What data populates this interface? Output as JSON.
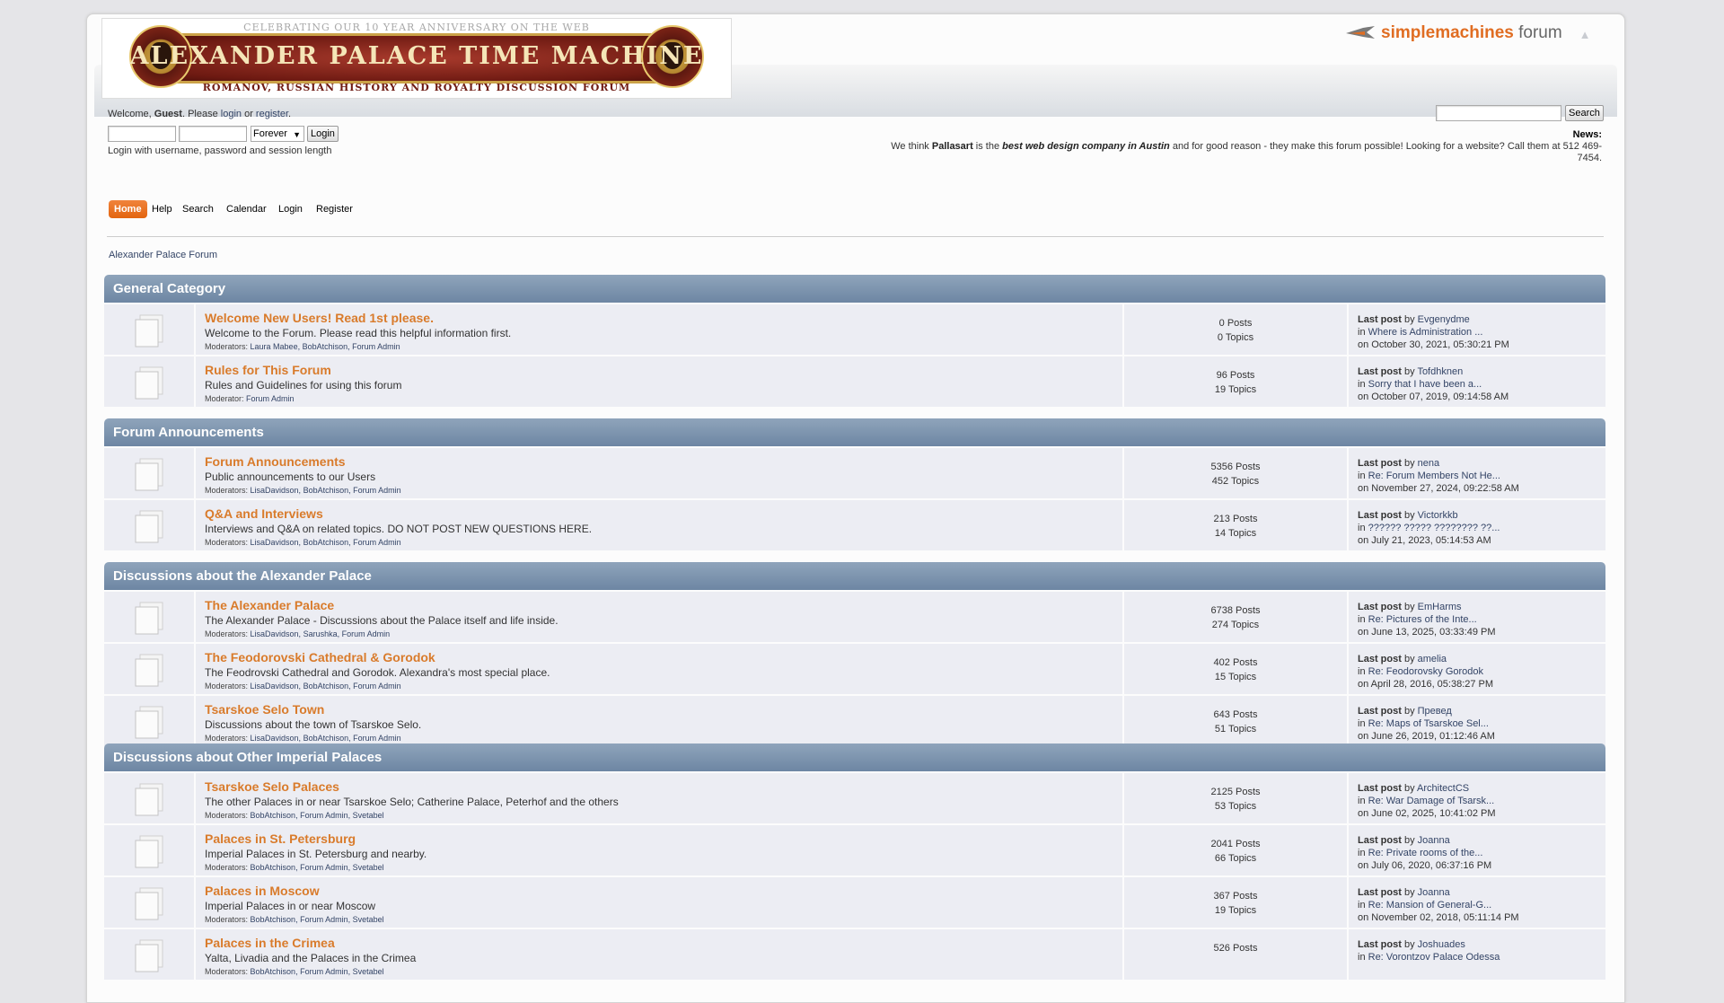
{
  "header": {
    "anniversary": "Celebrating our 10 year anniversary on the web",
    "title": "Alexander Palace Time Machine",
    "subtitle": "Romanov, Russian History and Royalty Discussion Forum",
    "smf_logo_bold": "simplemachines",
    "smf_logo_rest": " forum",
    "collapse_icon": "collapse-icon"
  },
  "user": {
    "welcome_prefix": "Welcome, ",
    "guest": "Guest",
    "please": ". Please ",
    "login_link": "login",
    "or": " or ",
    "register_link": "register",
    "end": ".",
    "login_length": "Forever",
    "login_button": "Login",
    "hint": "Login with username, password and session length"
  },
  "search": {
    "button": "Search",
    "value": ""
  },
  "news": {
    "title": "News:",
    "p1": "We think ",
    "b1": "Pallasart",
    "p2": " is the ",
    "b2": "best web design company in Austin",
    "p3": " and for good reason - they make this forum possible! Looking for a website? Call them at 512 469-7454."
  },
  "menu": [
    "Home",
    "Help",
    "Search",
    "Calendar",
    "Login",
    "Register"
  ],
  "breadcrumb": "Alexander Palace Forum",
  "categories": [
    {
      "name": "General Category",
      "boards": [
        {
          "name": "Welcome New Users! Read 1st please.",
          "desc": "Welcome to the Forum. Please read this helpful information first.",
          "mods_label": "Moderators: ",
          "mods": "Laura Mabee, BobAtchison, Forum Admin",
          "posts": "0 Posts",
          "topics": "0 Topics",
          "last_by": "Evgenydme",
          "last_in": "Where is Administration ...",
          "last_on": "on October 30, 2021, 05:30:21 PM"
        },
        {
          "name": "Rules for This Forum",
          "desc": "Rules and Guidelines for using this forum",
          "mods_label": "Moderator: ",
          "mods": "Forum Admin",
          "posts": "96 Posts",
          "topics": "19 Topics",
          "last_by": "Tofdhknen",
          "last_in": "Sorry that I have been a...",
          "last_on": "on October 07, 2019, 09:14:58 AM"
        }
      ]
    },
    {
      "name": "Forum Announcements",
      "boards": [
        {
          "name": "Forum Announcements",
          "desc": "Public announcements to our Users",
          "mods_label": "Moderators: ",
          "mods": "LisaDavidson, BobAtchison, Forum Admin",
          "posts": "5356 Posts",
          "topics": "452 Topics",
          "last_by": "nena",
          "last_in": "Re: Forum Members Not He...",
          "last_on": "on November 27, 2024, 09:22:58 AM"
        },
        {
          "name": "Q&A and Interviews",
          "desc": "Interviews and Q&A on related topics. DO NOT POST NEW QUESTIONS HERE.",
          "mods_label": "Moderators: ",
          "mods": "LisaDavidson, BobAtchison, Forum Admin",
          "posts": "213 Posts",
          "topics": "14 Topics",
          "last_by": "Victorkkb",
          "last_in": "?????? ????? ???????? ??...",
          "last_on": "on July 21, 2023, 05:14:53 AM"
        }
      ]
    },
    {
      "name": "Discussions about the Alexander Palace",
      "boards": [
        {
          "name": "The Alexander Palace",
          "desc": "The Alexander Palace - Discussions about the Palace itself and life inside.",
          "mods_label": "Moderators: ",
          "mods": "LisaDavidson, Sarushka, Forum Admin",
          "posts": "6738 Posts",
          "topics": "274 Topics",
          "last_by": "EmHarms",
          "last_in": "Re: Pictures of the Inte...",
          "last_on": "on June 13, 2025, 03:33:49 PM"
        },
        {
          "name": "The Feodorovski Cathedral & Gorodok",
          "desc": "The Feodrovski Cathedral and Gorodok. Alexandra's most special place.",
          "mods_label": "Moderators: ",
          "mods": "LisaDavidson, BobAtchison, Forum Admin",
          "posts": "402 Posts",
          "topics": "15 Topics",
          "last_by": "amelia",
          "last_in": "Re: Feodorovsky Gorodok",
          "last_on": "on April 28, 2016, 05:38:27 PM"
        },
        {
          "name": "Tsarskoe Selo Town",
          "desc": "Discussions about the town of Tsarskoe Selo.",
          "mods_label": "Moderators: ",
          "mods": "LisaDavidson, BobAtchison, Forum Admin",
          "posts": "643 Posts",
          "topics": "51 Topics",
          "last_by": "Превед",
          "last_in": "Re: Maps of Tsarskoe Sel...",
          "last_on": "on June 26, 2019, 01:12:46 AM"
        }
      ]
    },
    {
      "name": "Discussions about Other Imperial Palaces",
      "boards": [
        {
          "name": "Tsarskoe Selo Palaces",
          "desc": "The other Palaces in or near Tsarskoe Selo; Catherine Palace, Peterhof and the others",
          "mods_label": "Moderators: ",
          "mods": "BobAtchison, Forum Admin, Svetabel",
          "posts": "2125 Posts",
          "topics": "53 Topics",
          "last_by": "ArchitectCS",
          "last_in": "Re: War Damage of Tsarsk...",
          "last_on": "on June 02, 2025, 10:41:02 PM"
        },
        {
          "name": "Palaces in St. Petersburg",
          "desc": "Imperial Palaces in St. Petersburg and nearby.",
          "mods_label": "Moderators: ",
          "mods": "BobAtchison, Forum Admin, Svetabel",
          "posts": "2041 Posts",
          "topics": "66 Topics",
          "last_by": "Joanna",
          "last_in": "Re: Private rooms of the...",
          "last_on": "on July 06, 2020, 06:37:16 PM"
        },
        {
          "name": "Palaces in Moscow",
          "desc": "Imperial Palaces in or near Moscow",
          "mods_label": "Moderators: ",
          "mods": "BobAtchison, Forum Admin, Svetabel",
          "posts": "367 Posts",
          "topics": "19 Topics",
          "last_by": "Joanna",
          "last_in": "Re: Mansion of General-G...",
          "last_on": "on November 02, 2018, 05:11:14 PM"
        },
        {
          "name": "Palaces in the Crimea",
          "desc": "Yalta, Livadia and the Palaces in the Crimea",
          "mods_label": "Moderators: ",
          "mods": "BobAtchison, Forum Admin, Svetabel",
          "posts": "526 Posts",
          "topics": "",
          "last_by": "Joshuades",
          "last_in": "Re: Vorontzov Palace Odessa",
          "last_on": ""
        }
      ]
    }
  ],
  "labels": {
    "last_post": "Last post",
    "by": " by ",
    "in": "in "
  }
}
